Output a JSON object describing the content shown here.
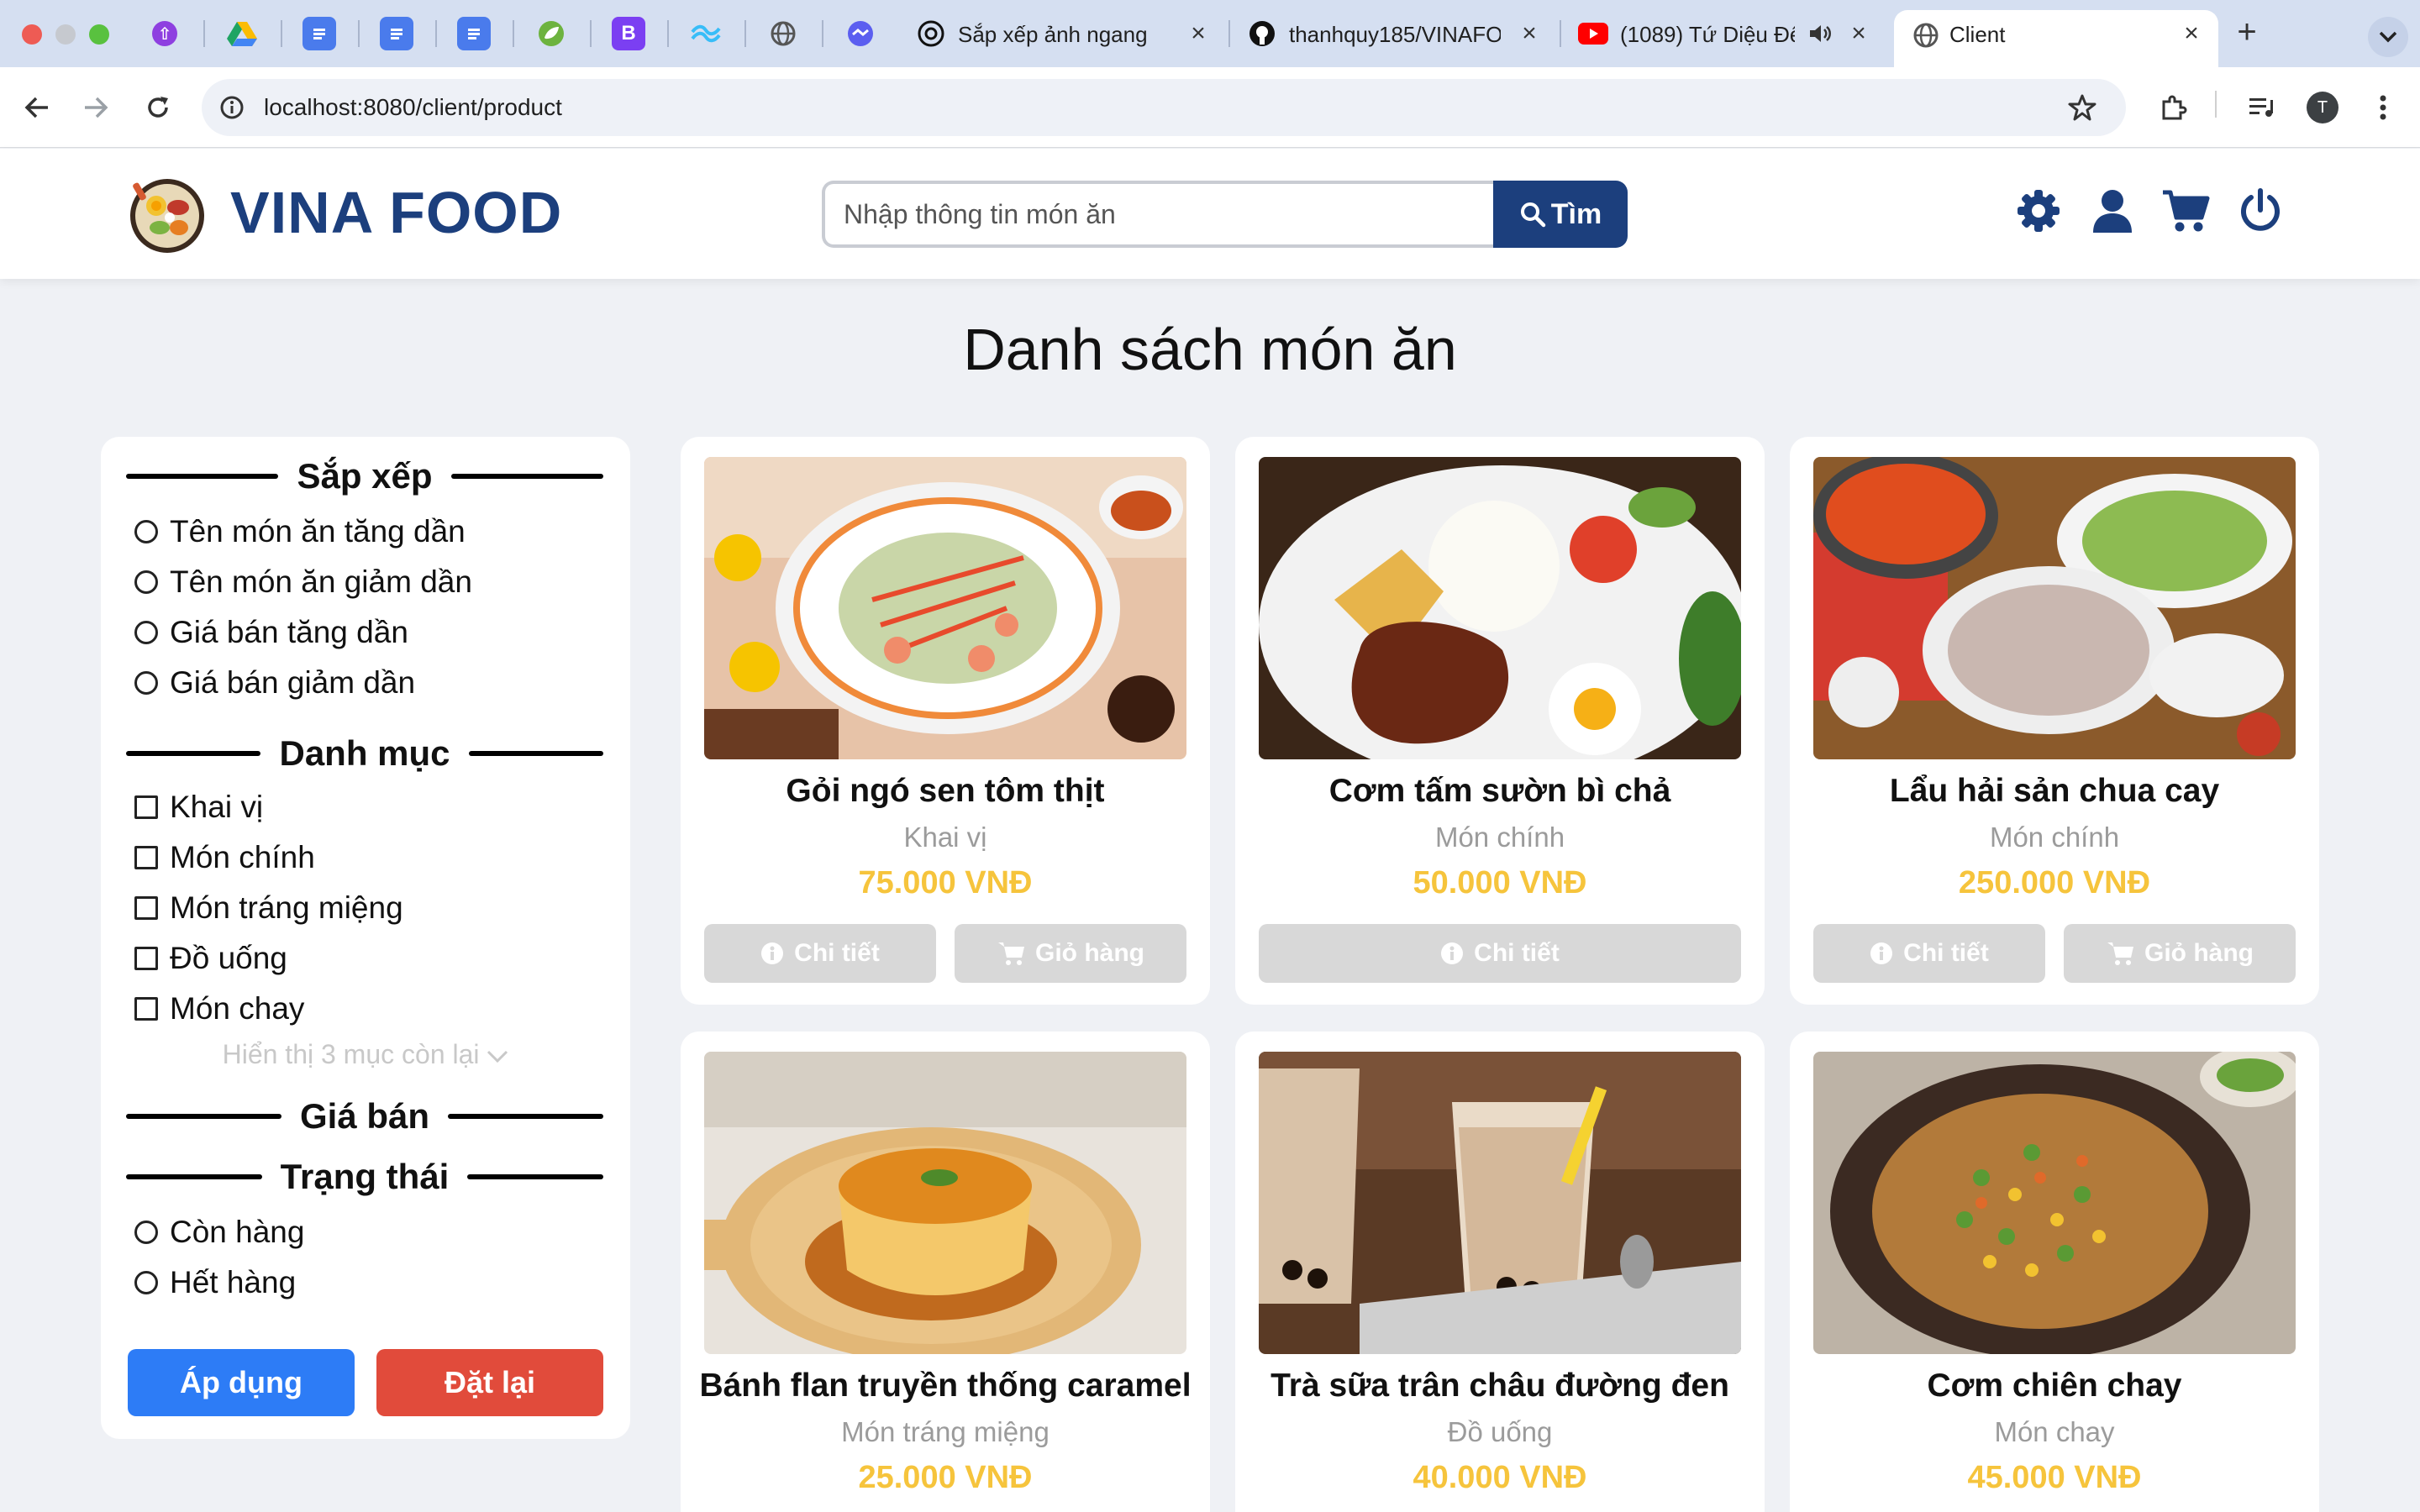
{
  "browser": {
    "tabs": [
      {
        "title": "Sắp xếp ảnh ngang"
      },
      {
        "title": "thanhquy185/VINAFOOD"
      },
      {
        "title": "(1089) Tứ Diệu Đế"
      },
      {
        "title": "Client"
      }
    ],
    "url": "localhost:8080/client/product",
    "profile_initial": "T"
  },
  "header": {
    "brand": "VINA FOOD",
    "search_placeholder": "Nhập thông tin món ăn",
    "search_button": "Tìm"
  },
  "page_title": "Danh sách món ăn",
  "filters": {
    "sort": {
      "title": "Sắp xếp",
      "options": [
        "Tên món ăn tăng dần",
        "Tên món ăn giảm dần",
        "Giá bán tăng dần",
        "Giá bán giảm dần"
      ]
    },
    "category": {
      "title": "Danh mục",
      "options": [
        "Khai vị",
        "Món chính",
        "Món tráng miệng",
        "Đồ uống",
        "Món chay"
      ],
      "more": "Hiển thị 3 mục còn lại"
    },
    "price": {
      "title": "Giá bán"
    },
    "status": {
      "title": "Trạng thái",
      "options": [
        "Còn hàng",
        "Hết hàng"
      ]
    },
    "apply": "Áp dụng",
    "reset": "Đặt lại"
  },
  "products": [
    {
      "name": "Gỏi ngó sen tôm thịt",
      "category": "Khai vị",
      "price": "75.000 VNĐ",
      "detail": "Chi tiết",
      "cart": "Giỏ hàng"
    },
    {
      "name": "Cơm tấm sườn bì chả",
      "category": "Món chính",
      "price": "50.000 VNĐ",
      "detail": "Chi tiết"
    },
    {
      "name": "Lẩu hải sản chua cay",
      "category": "Món chính",
      "price": "250.000 VNĐ",
      "detail": "Chi tiết",
      "cart": "Giỏ hàng"
    },
    {
      "name": "Bánh flan truyền thống caramel",
      "category": "Món tráng miệng",
      "price": "25.000 VNĐ"
    },
    {
      "name": "Trà sữa trân châu đường đen",
      "category": "Đồ uống",
      "price": "40.000 VNĐ"
    },
    {
      "name": "Cơm chiên chay",
      "category": "Món chay",
      "price": "45.000 VNĐ"
    }
  ],
  "colors": {
    "brand": "#1c3f7d",
    "price": "#f6c43c",
    "apply": "#2d7cf6",
    "reset": "#e14b3b",
    "disabled_button": "#d8d8d8"
  }
}
